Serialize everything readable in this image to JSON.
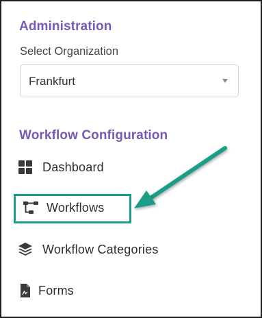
{
  "admin_section": {
    "title": "Administration",
    "org_select": {
      "label": "Select Organization",
      "selected": "Frankfurt"
    }
  },
  "workflow_section": {
    "title": "Workflow Configuration",
    "items": [
      {
        "label": "Dashboard",
        "icon": "dashboard-grid-icon"
      },
      {
        "label": "Workflows",
        "icon": "workflow-nodes-icon",
        "highlighted": true
      },
      {
        "label": "Workflow Categories",
        "icon": "layers-icon"
      },
      {
        "label": "Forms",
        "icon": "form-document-icon"
      }
    ]
  },
  "annotation": {
    "highlight_color": "#1c9d87",
    "arrow_color": "#1c9d87"
  },
  "colors": {
    "section_title": "#7a58b6",
    "text": "#2f2f2f"
  }
}
